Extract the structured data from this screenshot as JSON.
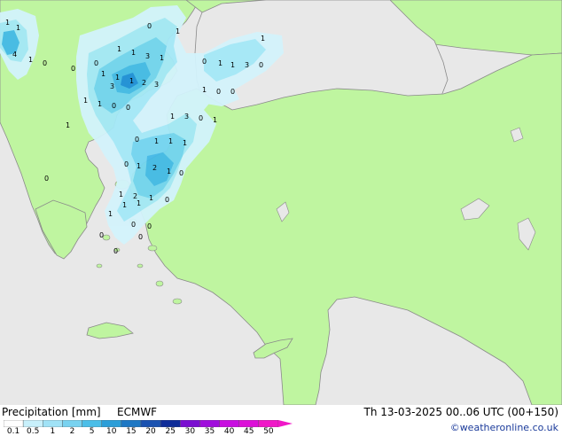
{
  "map": {
    "sea_color": "#e8e8e8",
    "land_color": "#bff5a0",
    "coast_color": "#8a8a8a",
    "precip_colors": [
      "#d3f3fc",
      "#a4e8f7",
      "#73d4f0",
      "#43b9e7",
      "#1e8ed8"
    ],
    "values": [
      "1",
      "1",
      "4",
      "1",
      "0",
      "0",
      "0",
      "1",
      "1",
      "1",
      "3",
      "1",
      "0",
      "1",
      "1",
      "1",
      "2",
      "3",
      "3",
      "0",
      "1",
      "1",
      "3",
      "0",
      "1",
      "1",
      "0",
      "0",
      "1",
      "1",
      "0",
      "0",
      "1",
      "3",
      "0",
      "1",
      "1",
      "0",
      "1",
      "1",
      "1",
      "0",
      "1",
      "2",
      "1",
      "1",
      "2",
      "1",
      "1",
      "1",
      "1",
      "0",
      "0",
      "0",
      "0",
      "0",
      "0",
      "0",
      "0"
    ]
  },
  "legend": {
    "title": "Precipitation [mm]",
    "product": "ECMWF",
    "valid": "Th 13-03-2025 00..06 UTC (00+150)",
    "credit": "©weatheronline.co.uk",
    "ticks": [
      "0.1",
      "0.5",
      "1",
      "2",
      "5",
      "10",
      "15",
      "20",
      "25",
      "30",
      "35",
      "40",
      "45",
      "50"
    ],
    "colors": [
      "#fefefe",
      "#c8f0fb",
      "#a0e2f6",
      "#78d2f0",
      "#4bbee8",
      "#2c9ed8",
      "#1e78c4",
      "#1a52b0",
      "#0e2c98",
      "#7a0ed0",
      "#a00edc",
      "#c80ee0",
      "#dc10d8",
      "#f018c8"
    ]
  }
}
